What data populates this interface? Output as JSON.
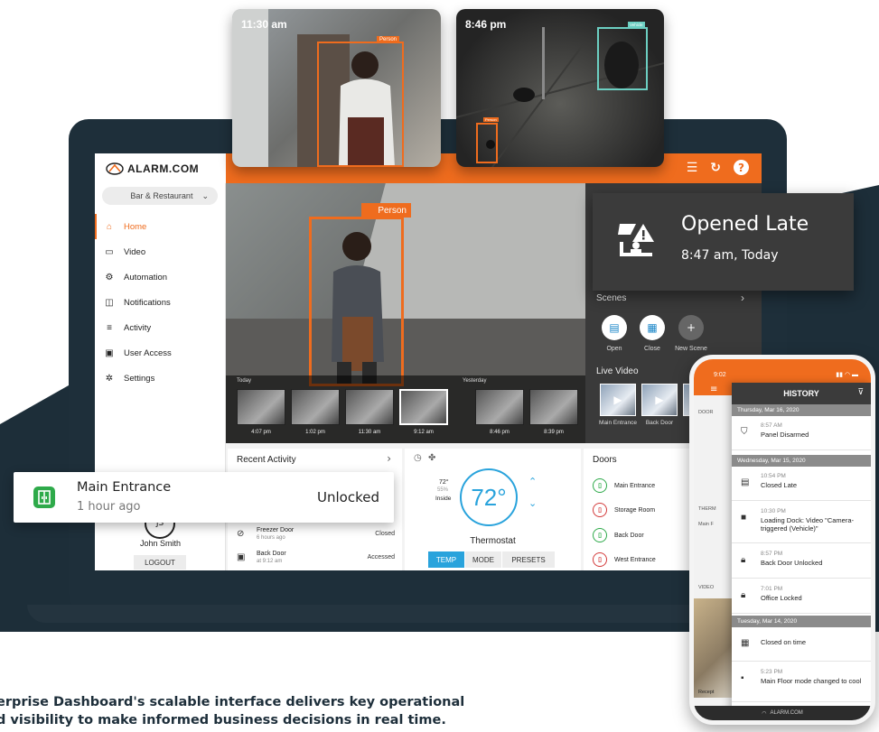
{
  "app": {
    "brand": "ALARM.COM",
    "site_selector": "Bar & Restaurant",
    "nav": [
      {
        "label": "Home",
        "icon": "home-icon"
      },
      {
        "label": "Video",
        "icon": "video-camera-icon"
      },
      {
        "label": "Automation",
        "icon": "automation-icon"
      },
      {
        "label": "Notifications",
        "icon": "notification-icon"
      },
      {
        "label": "Activity",
        "icon": "activity-icon"
      },
      {
        "label": "User Access",
        "icon": "user-access-icon"
      },
      {
        "label": "Settings",
        "icon": "gear-icon"
      }
    ],
    "user_name": "John Smith",
    "logout_label": "LOGOUT",
    "avatar_text": "JS"
  },
  "main_video": {
    "detection_label": "Person",
    "timeline_today": "Today",
    "timeline_yesterday": "Yesterday",
    "thumb_times": [
      "4:07 pm",
      "1:02 pm",
      "11:30 am",
      "9:12 am",
      "8:46 pm",
      "8:39 pm"
    ]
  },
  "right_panel": {
    "scenes_label": "Scenes",
    "scenes": [
      "Open",
      "Close",
      "New Scene"
    ],
    "live_video_label": "Live Video",
    "live_cams": [
      "Main Entrance",
      "Back Door",
      "E..."
    ]
  },
  "recent_activity": {
    "title": "Recent Activity",
    "rows": [
      {
        "title": "Freezer Door",
        "time": "6 hours ago",
        "status": "Closed"
      },
      {
        "title": "Back Door",
        "time": "at 9:12 am",
        "status": "Accessed"
      }
    ]
  },
  "thermostat": {
    "inside_temp": "72°",
    "humidity": "55%",
    "inside_label": "Inside",
    "setpoint": "72°",
    "label": "Thermostat",
    "tabs": [
      "TEMP",
      "MODE",
      "PRESETS"
    ]
  },
  "doors": {
    "title": "Doors",
    "items": [
      {
        "name": "Main Entrance",
        "state": "open"
      },
      {
        "name": "Storage Room",
        "state": "closed"
      },
      {
        "name": "Back Door",
        "state": "open"
      },
      {
        "name": "West Entrance",
        "state": "closed"
      }
    ]
  },
  "camera_popups": [
    {
      "time": "11:30 am",
      "label": "Person"
    },
    {
      "time": "8:46 pm",
      "label": "Person",
      "vehicle_label": "Vehicle"
    }
  ],
  "opened_late": {
    "title": "Opened Late",
    "time": "8:47 am, Today"
  },
  "entrance_notice": {
    "title": "Main Entrance",
    "time": "1 hour ago",
    "status": "Unlocked"
  },
  "phone": {
    "clock": "9:02",
    "history_title": "HISTORY",
    "under_labels": [
      "DOOR",
      "THERM",
      "Main F",
      "VIDEO",
      "Recept"
    ],
    "groups": [
      {
        "date": "Thursday, Mar 16, 2020",
        "items": [
          {
            "time": "8:57 AM",
            "text": "Panel Disarmed",
            "icon": "shield-icon"
          }
        ]
      },
      {
        "date": "Wednesday, Mar 15, 2020",
        "items": [
          {
            "time": "10:54 PM",
            "text": "Closed Late",
            "icon": "store-alert-icon"
          },
          {
            "time": "10:30 PM",
            "text": "Loading Dock: Video \"Camera-triggered (Vehicle)\"",
            "icon": "video-camera-icon"
          },
          {
            "time": "8:57 PM",
            "text": "Back Door Unlocked",
            "icon": "lock-icon"
          },
          {
            "time": "7:01 PM",
            "text": "Office Locked",
            "icon": "lock-icon"
          }
        ]
      },
      {
        "date": "Tuesday, Mar 14, 2020",
        "items": [
          {
            "time": "",
            "text": "Closed on time",
            "icon": "store-icon"
          },
          {
            "time": "5:23 PM",
            "text": "Main Floor mode changed to cool",
            "icon": "thermostat-icon"
          }
        ]
      }
    ],
    "footer": "ALARM.COM"
  },
  "caption": {
    "line1": "erprise Dashboard's scalable interface delivers key operational",
    "line2": "d visibility to make informed business decisions in real time."
  },
  "colors": {
    "accent": "#ef6c1e",
    "dark_bg": "#1e2f3a",
    "open_green": "#2eaa4a",
    "closed_red": "#d33b3b",
    "thermo_blue": "#29a3dc"
  }
}
